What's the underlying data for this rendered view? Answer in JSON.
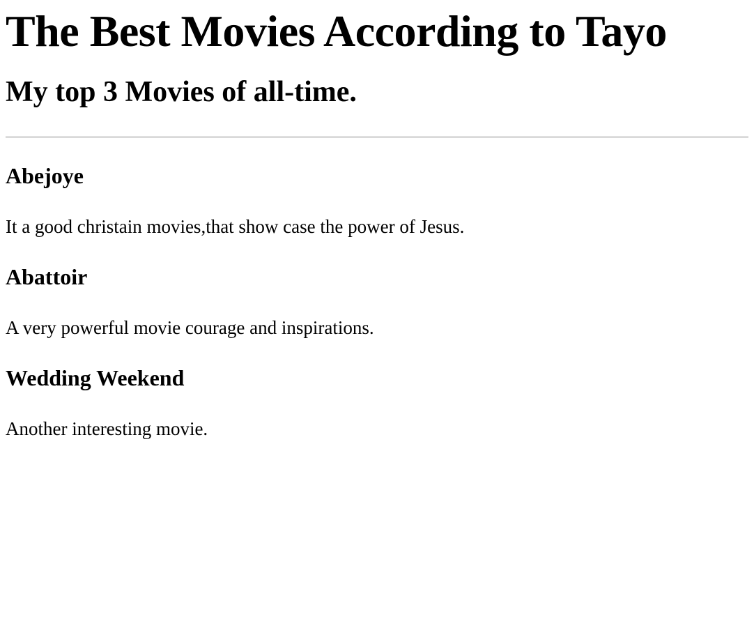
{
  "page": {
    "title": "The Best Movies According to Tayo",
    "subtitle": "My top 3 Movies of all-time."
  },
  "movies": [
    {
      "title": "Abejoye",
      "description": "It a good christain movies,that show case the power of Jesus."
    },
    {
      "title": "Abattoir",
      "description": "A very powerful movie courage and inspirations."
    },
    {
      "title": "Wedding Weekend",
      "description": "Another interesting movie."
    }
  ]
}
